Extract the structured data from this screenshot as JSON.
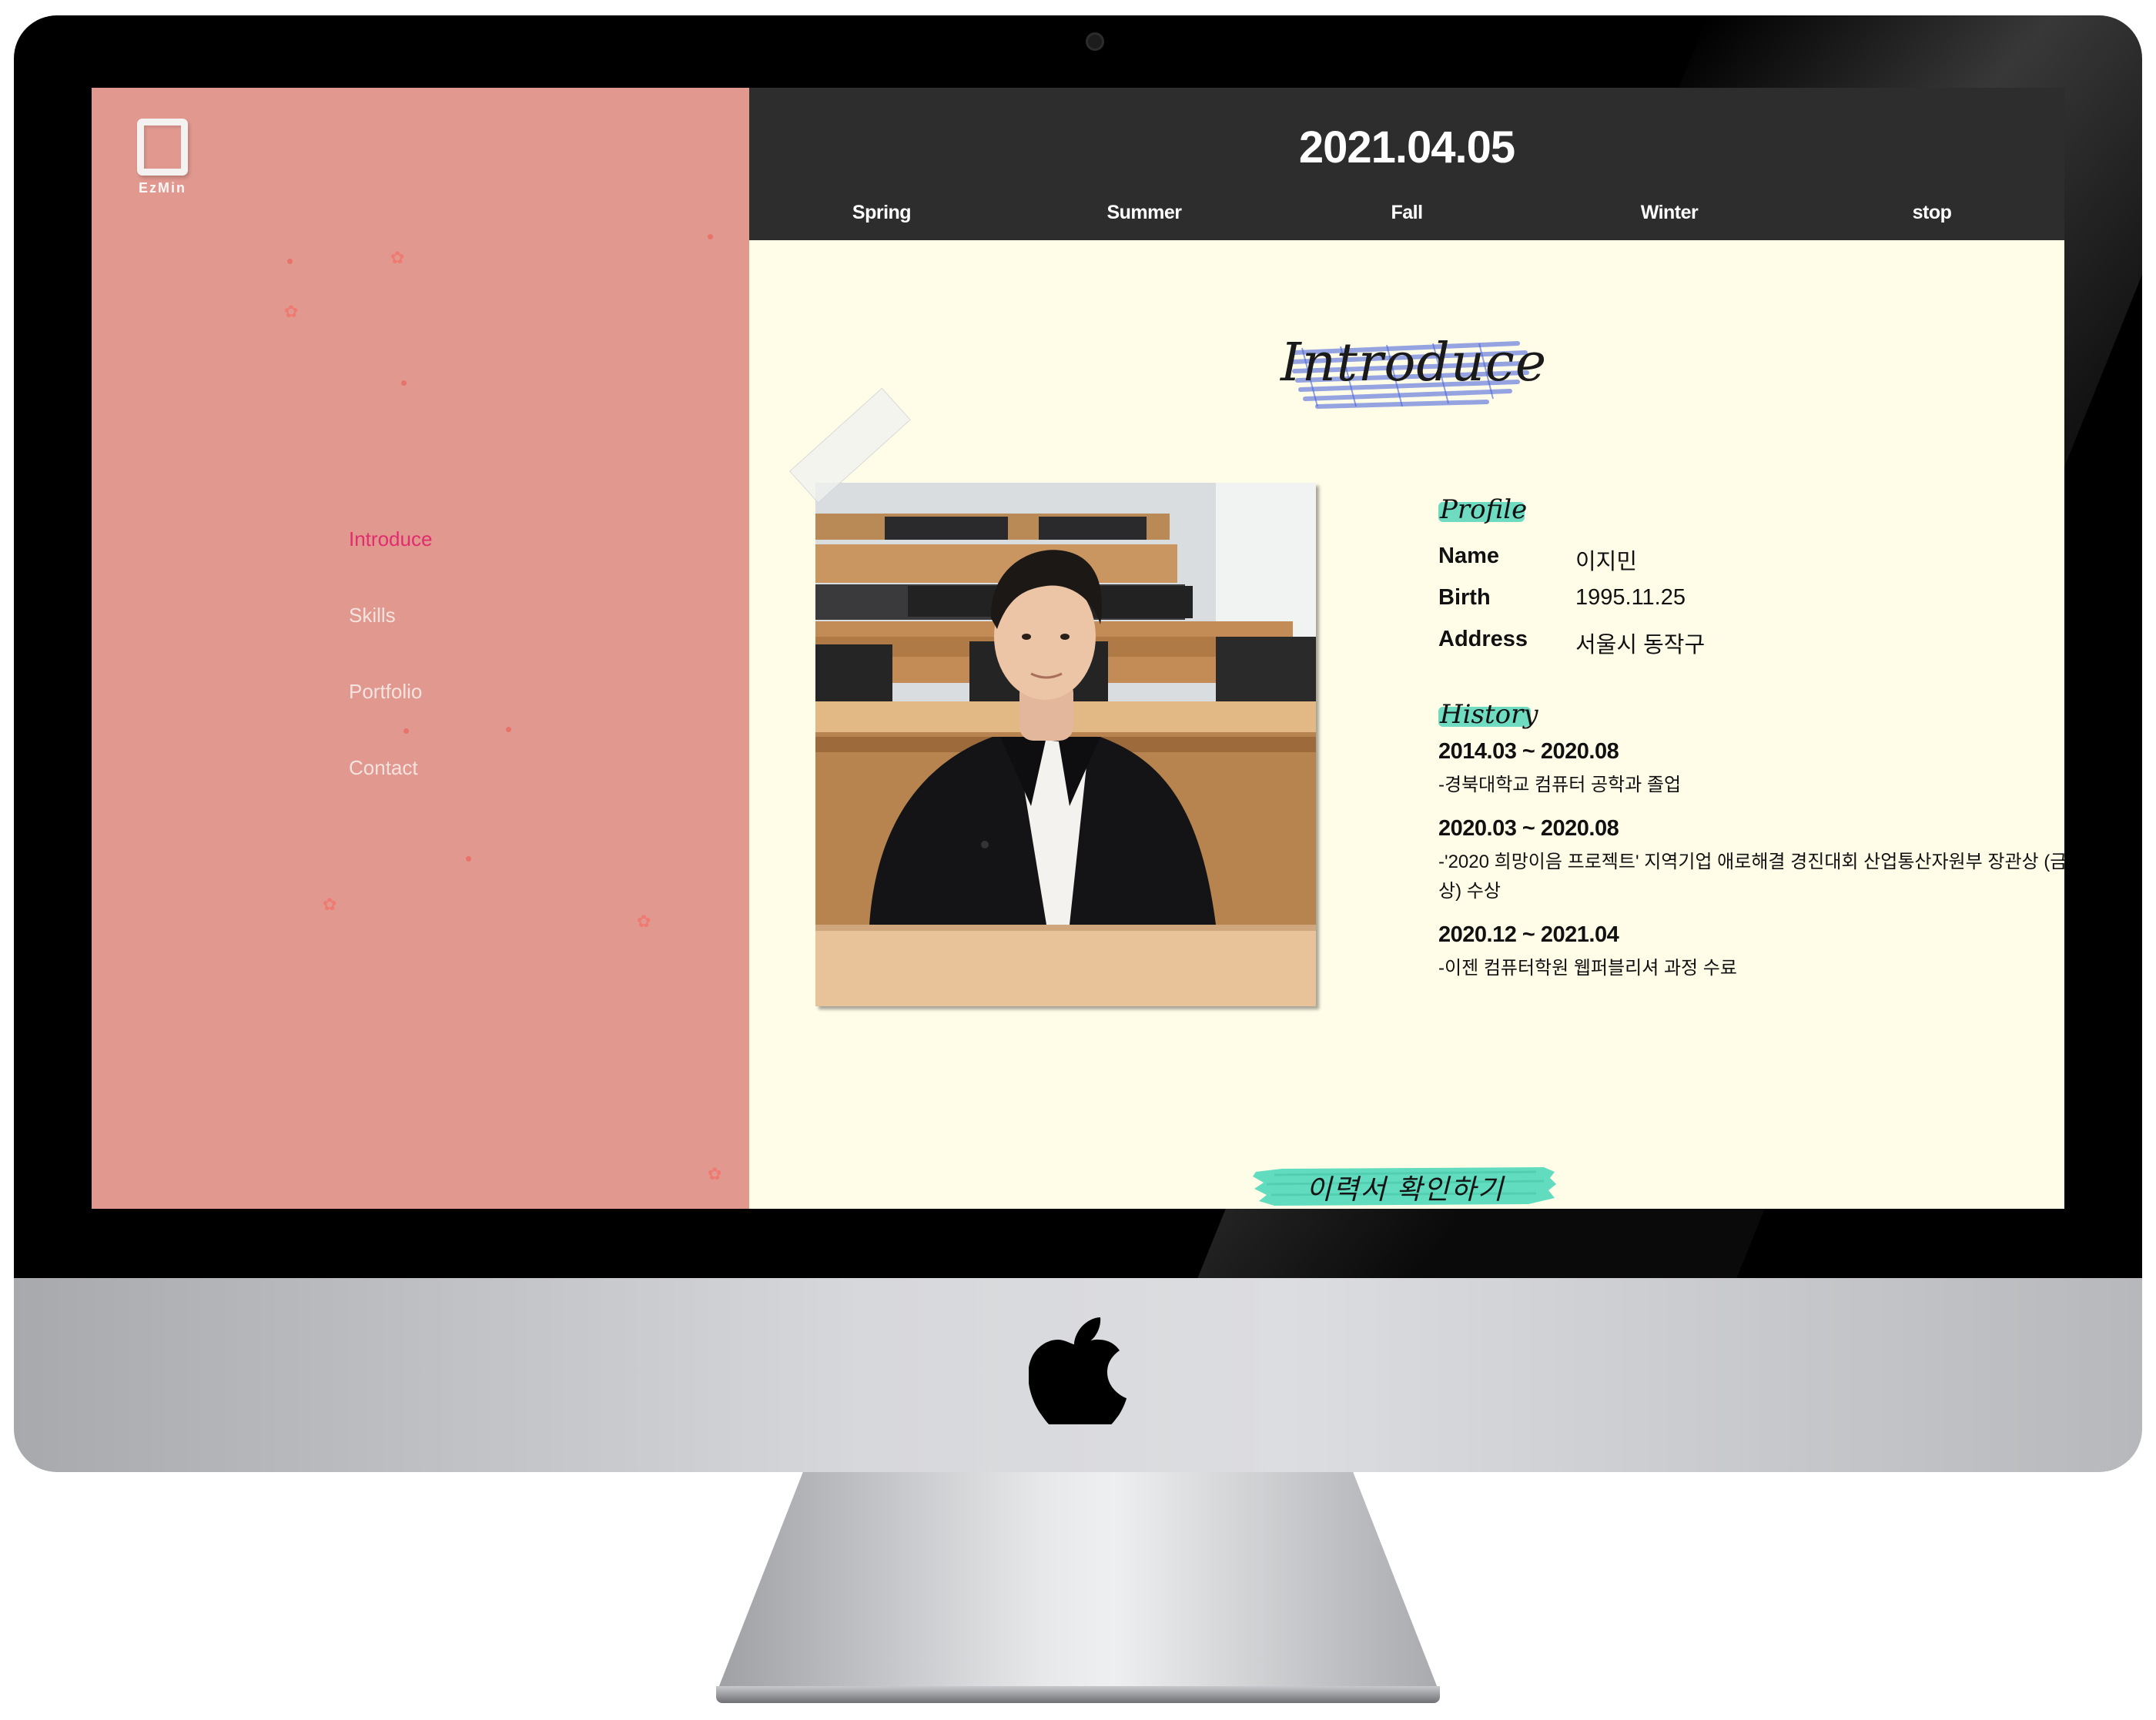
{
  "site": {
    "logo_text": "EzMin",
    "date": "2021.04.05",
    "season_tabs": [
      "Spring",
      "Summer",
      "Fall",
      "Winter",
      "stop"
    ]
  },
  "sidebar": {
    "nav": [
      {
        "label": "Introduce",
        "active": true
      },
      {
        "label": "Skills",
        "active": false
      },
      {
        "label": "Portfolio",
        "active": false
      },
      {
        "label": "Contact",
        "active": false
      }
    ]
  },
  "main": {
    "heading": "Introduce",
    "profile": {
      "title": "Profile",
      "rows": [
        {
          "key": "Name",
          "value": "이지민"
        },
        {
          "key": "Birth",
          "value": "1995.11.25"
        },
        {
          "key": "Address",
          "value": "서울시 동작구"
        }
      ]
    },
    "history": {
      "title": "History",
      "items": [
        {
          "period": "2014.03 ~ 2020.08",
          "desc": "-경북대학교 컴퓨터 공학과 졸업"
        },
        {
          "period": "2020.03 ~ 2020.08",
          "desc": "-'2020 희망이음 프로젝트' 지역기업 애로해결 경진대회 산업통산자원부 장관상 (금상) 수상"
        },
        {
          "period": "2020.12 ~ 2021.04",
          "desc": "-이젠 컴퓨터학원 웹퍼블리셔 과정 수료"
        }
      ]
    },
    "resume_button": "이력서 확인하기",
    "top_button_icon": "arrow-up-icon"
  },
  "colors": {
    "sidebar_bg": "#e0988f",
    "topbar_bg": "#2d2d2d",
    "content_bg": "#fffde8",
    "nav_active": "#e02d6f",
    "label_highlight": "#6fdbc0",
    "heading_scribble": "#7b8fe0"
  }
}
